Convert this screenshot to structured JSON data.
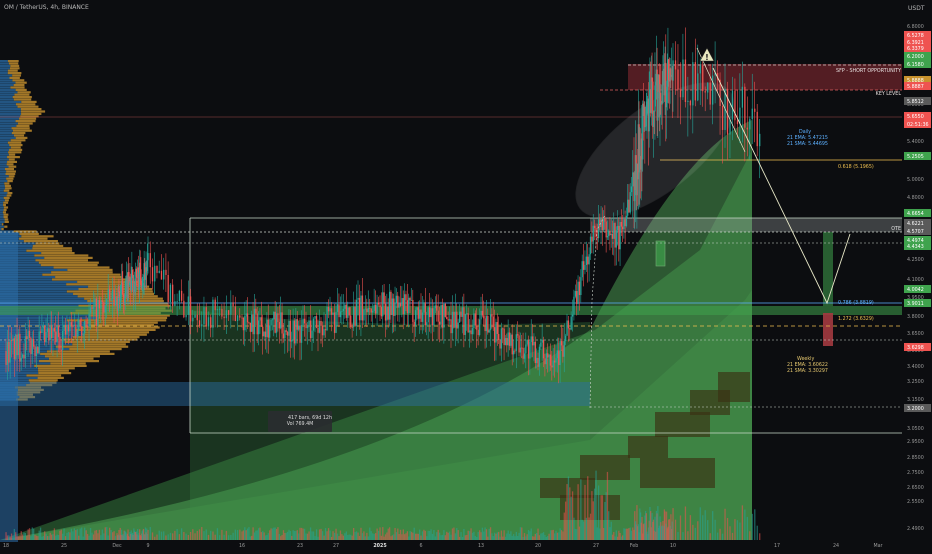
{
  "header": {
    "symbol_line": "OM / TetherUS, 4h, BINANCE",
    "currency": "USDT"
  },
  "colors": {
    "background": "#0c0d10",
    "candle_up": "#26a69a",
    "candle_down": "#ef5350",
    "green_zone": "#3fa34d",
    "red_zone": "#8e2b33",
    "volume_profile_blue": "#2b6ea8",
    "volume_profile_orange": "#c8922e",
    "level_line": "#c8d8c8",
    "fib_line": "#f0c050",
    "annotation_text": "#e0e0b0"
  },
  "chart_data": {
    "type": "candlestick",
    "symbol": "OM/USDT",
    "timeframe": "4h",
    "exchange": "BINANCE",
    "scale": "log",
    "ylim": [
      2.48,
      7.0
    ],
    "x_tick_labels": [
      "18",
      "25",
      "Dec",
      "9",
      "16",
      "23",
      "27",
      "2025",
      "6",
      "13",
      "20",
      "27",
      "Feb",
      "10",
      "17",
      "24",
      "Mar"
    ],
    "y_ticks": [
      6.8,
      6.0,
      5.8,
      5.4,
      5.2,
      5.0,
      4.8,
      4.6,
      4.25,
      4.1,
      3.95,
      3.8,
      3.65,
      3.5,
      3.4,
      3.25,
      3.15,
      3.05,
      2.95,
      2.85,
      2.75,
      2.65,
      2.55,
      2.49
    ],
    "price_tags": [
      {
        "value": "6.5278",
        "color": "#ef5350"
      },
      {
        "value": "6.3921",
        "color": "#ef5350"
      },
      {
        "value": "6.3379",
        "color": "#ef5350"
      },
      {
        "value": "6.2000",
        "color": "#3fa34d"
      },
      {
        "value": "6.1580",
        "color": "#3fa34d"
      },
      {
        "value": "5.8888",
        "color": "#c8922e"
      },
      {
        "value": "5.8887",
        "color": "#ef5350"
      },
      {
        "value": "5.8512",
        "color": "#5a5a5a"
      },
      {
        "value": "5.6550",
        "color": "#ef5350"
      },
      {
        "value": "02:51:36",
        "color": "#ef5350"
      },
      {
        "value": "5.2505",
        "color": "#3fa34d"
      },
      {
        "value": "4.6654",
        "color": "#3fa34d"
      },
      {
        "value": "4.6221",
        "color": "#5a5a5a"
      },
      {
        "value": "4.5707",
        "color": "#5a5a5a"
      },
      {
        "value": "4.4974",
        "color": "#3fa34d"
      },
      {
        "value": "4.4343",
        "color": "#3fa34d"
      },
      {
        "value": "4.0042",
        "color": "#3fa34d"
      },
      {
        "value": "3.9011",
        "color": "#3fa34d"
      },
      {
        "value": "3.6298",
        "color": "#ef5350"
      },
      {
        "value": "3.2000",
        "color": "#5a5a5a"
      }
    ],
    "levels": [
      {
        "label": "SFP - SHORT OPPORTUNITY",
        "value": 6.2,
        "style": "dashed"
      },
      {
        "label": "KEY LEVEL",
        "value": 5.8887,
        "style": "dashed"
      },
      {
        "label": "0.618 (5.1965)",
        "value": 5.1965,
        "style": "solid-fib"
      },
      {
        "label": "OTE",
        "value": 4.6,
        "style": "band"
      },
      {
        "label": "0.786 (3.8819)",
        "value": 3.8819,
        "style": "solid"
      },
      {
        "label": "1.272 (3.6329)",
        "value": 3.6329,
        "style": "dashed-fib"
      }
    ],
    "annotations": [
      {
        "title": "Daily",
        "lines": [
          "21 EMA: 5.47215",
          "21 SMA: 5.44695"
        ]
      },
      {
        "title": "Weekly",
        "lines": [
          "21 EMA: 3.60622",
          "21 SMA: 3.30297"
        ]
      },
      {
        "title": "417 bars, 69d 12h",
        "lines": [
          "Vol 769.4M"
        ]
      }
    ],
    "ohlc_anchors": [
      {
        "x": "Nov 27",
        "close": 3.72
      },
      {
        "x": "Dec 9",
        "close": 4.25
      },
      {
        "x": "Dec 23",
        "close": 3.75
      },
      {
        "x": "Jan 1",
        "close": 3.95
      },
      {
        "x": "Jan 13",
        "close": 3.8
      },
      {
        "x": "Jan 22",
        "close": 3.58
      },
      {
        "x": "Jan 27",
        "close": 4.6
      },
      {
        "x": "Feb 2",
        "close": 5.6
      },
      {
        "x": "Feb 8",
        "close": 6.1
      },
      {
        "x": "Feb 13",
        "close": 5.66
      }
    ],
    "last_price": 5.655
  }
}
